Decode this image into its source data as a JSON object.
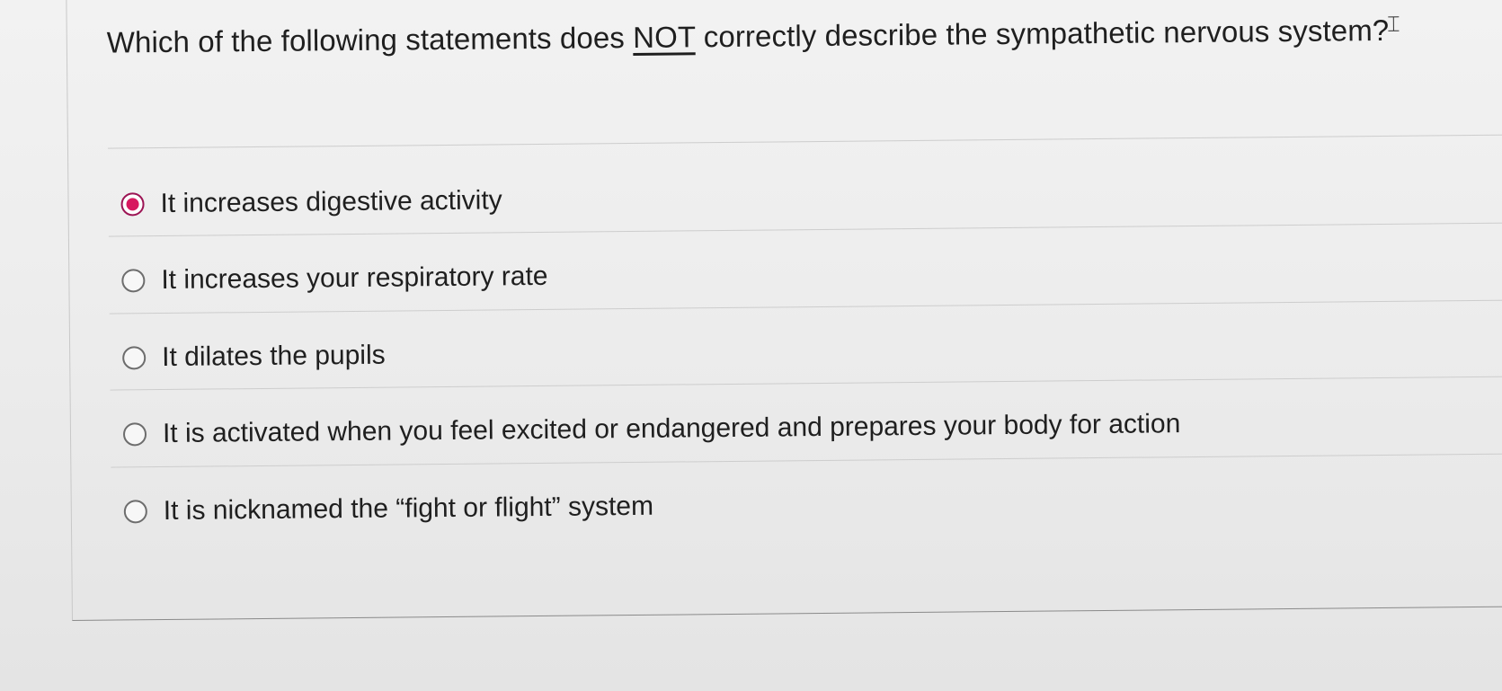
{
  "question": {
    "text_before": "Which of the following statements does ",
    "emphasis": "NOT",
    "text_after": " correctly describe the sympathetic nervous system?"
  },
  "options": [
    {
      "label": "It increases digestive activity",
      "selected": true
    },
    {
      "label": "It increases your respiratory rate",
      "selected": false
    },
    {
      "label": "It dilates the pupils",
      "selected": false
    },
    {
      "label": "It is activated when you feel excited or endangered and prepares your body for action",
      "selected": false
    },
    {
      "label": "It is nicknamed the “fight or flight” system",
      "selected": false
    }
  ],
  "colors": {
    "selected_radio": "#d7195f",
    "text": "#1f1f1f"
  }
}
